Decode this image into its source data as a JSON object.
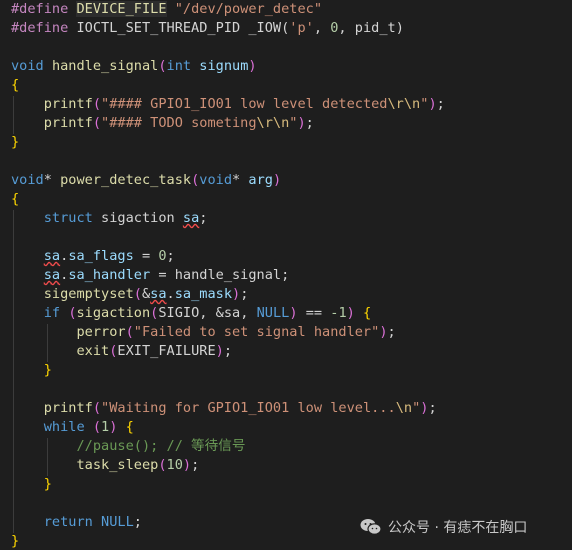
{
  "code_lines": [
    [
      {
        "c": "tok-pp",
        "t": "#define "
      },
      {
        "c": "tok-hl",
        "t": "DEVICE_FILE"
      },
      {
        "c": "tok-plain",
        "t": " "
      },
      {
        "c": "tok-str",
        "t": "\"/dev/power_detec\""
      }
    ],
    [
      {
        "c": "tok-pp",
        "t": "#define "
      },
      {
        "c": "tok-plain",
        "t": "IOCTL_SET_THREAD_PID _IOW("
      },
      {
        "c": "tok-str",
        "t": "'p'"
      },
      {
        "c": "tok-plain",
        "t": ", "
      },
      {
        "c": "tok-num",
        "t": "0"
      },
      {
        "c": "tok-plain",
        "t": ", pid_t)"
      }
    ],
    [],
    [
      {
        "c": "tok-kw",
        "t": "void"
      },
      {
        "c": "tok-plain",
        "t": " "
      },
      {
        "c": "tok-fn",
        "t": "handle_signal"
      },
      {
        "c": "tok-paren",
        "t": "("
      },
      {
        "c": "tok-kw",
        "t": "int"
      },
      {
        "c": "tok-plain",
        "t": " "
      },
      {
        "c": "tok-var",
        "t": "signum"
      },
      {
        "c": "tok-paren",
        "t": ")"
      }
    ],
    [
      {
        "c": "tok-brace",
        "t": "{"
      }
    ],
    [
      {
        "c": "tok-plain",
        "t": "    "
      },
      {
        "c": "tok-fn",
        "t": "printf"
      },
      {
        "c": "tok-paren",
        "t": "("
      },
      {
        "c": "tok-str",
        "t": "\"#### GPIO1_IO01 low level detected"
      },
      {
        "c": "tok-esc",
        "t": "\\r\\n"
      },
      {
        "c": "tok-str",
        "t": "\""
      },
      {
        "c": "tok-paren",
        "t": ")"
      },
      {
        "c": "tok-plain",
        "t": ";"
      }
    ],
    [
      {
        "c": "tok-plain",
        "t": "    "
      },
      {
        "c": "tok-fn",
        "t": "printf"
      },
      {
        "c": "tok-paren",
        "t": "("
      },
      {
        "c": "tok-str",
        "t": "\"#### TODO someting"
      },
      {
        "c": "tok-esc",
        "t": "\\r\\n"
      },
      {
        "c": "tok-str",
        "t": "\""
      },
      {
        "c": "tok-paren",
        "t": ")"
      },
      {
        "c": "tok-plain",
        "t": ";"
      }
    ],
    [
      {
        "c": "tok-brace",
        "t": "}"
      }
    ],
    [],
    [
      {
        "c": "tok-kw",
        "t": "void"
      },
      {
        "c": "tok-plain",
        "t": "* "
      },
      {
        "c": "tok-fn",
        "t": "power_detec_task"
      },
      {
        "c": "tok-paren",
        "t": "("
      },
      {
        "c": "tok-kw",
        "t": "void"
      },
      {
        "c": "tok-plain",
        "t": "* "
      },
      {
        "c": "tok-var",
        "t": "arg"
      },
      {
        "c": "tok-paren",
        "t": ")"
      }
    ],
    [
      {
        "c": "tok-brace",
        "t": "{"
      }
    ],
    [
      {
        "c": "tok-plain",
        "t": "    "
      },
      {
        "c": "tok-kw",
        "t": "struct"
      },
      {
        "c": "tok-plain",
        "t": " sigaction "
      },
      {
        "c": "tok-var tok-sq",
        "t": "sa"
      },
      {
        "c": "tok-plain",
        "t": ";"
      }
    ],
    [],
    [
      {
        "c": "tok-plain",
        "t": "    "
      },
      {
        "c": "tok-var tok-sq",
        "t": "sa"
      },
      {
        "c": "tok-plain",
        "t": "."
      },
      {
        "c": "tok-var",
        "t": "sa_flags"
      },
      {
        "c": "tok-plain",
        "t": " = "
      },
      {
        "c": "tok-num",
        "t": "0"
      },
      {
        "c": "tok-plain",
        "t": ";"
      }
    ],
    [
      {
        "c": "tok-plain",
        "t": "    "
      },
      {
        "c": "tok-var tok-sq",
        "t": "sa"
      },
      {
        "c": "tok-plain",
        "t": "."
      },
      {
        "c": "tok-var",
        "t": "sa_handler"
      },
      {
        "c": "tok-plain",
        "t": " = handle_signal;"
      }
    ],
    [
      {
        "c": "tok-plain",
        "t": "    "
      },
      {
        "c": "tok-fn",
        "t": "sigemptyset"
      },
      {
        "c": "tok-paren",
        "t": "("
      },
      {
        "c": "tok-plain",
        "t": "&"
      },
      {
        "c": "tok-var tok-sq",
        "t": "sa"
      },
      {
        "c": "tok-plain",
        "t": "."
      },
      {
        "c": "tok-var",
        "t": "sa_mask"
      },
      {
        "c": "tok-paren",
        "t": ")"
      },
      {
        "c": "tok-plain",
        "t": ";"
      }
    ],
    [
      {
        "c": "tok-plain",
        "t": "    "
      },
      {
        "c": "tok-kw",
        "t": "if"
      },
      {
        "c": "tok-plain",
        "t": " "
      },
      {
        "c": "tok-paren",
        "t": "("
      },
      {
        "c": "tok-fn",
        "t": "sigaction"
      },
      {
        "c": "tok-paren",
        "t": "("
      },
      {
        "c": "tok-plain",
        "t": "SIGIO, &sa, "
      },
      {
        "c": "tok-kw",
        "t": "NULL"
      },
      {
        "c": "tok-paren",
        "t": ")"
      },
      {
        "c": "tok-plain",
        "t": " == "
      },
      {
        "c": "tok-num",
        "t": "-1"
      },
      {
        "c": "tok-paren",
        "t": ")"
      },
      {
        "c": "tok-plain",
        "t": " "
      },
      {
        "c": "tok-brace",
        "t": "{"
      }
    ],
    [
      {
        "c": "tok-plain",
        "t": "        "
      },
      {
        "c": "tok-fn",
        "t": "perror"
      },
      {
        "c": "tok-paren",
        "t": "("
      },
      {
        "c": "tok-str",
        "t": "\"Failed to set signal handler\""
      },
      {
        "c": "tok-paren",
        "t": ")"
      },
      {
        "c": "tok-plain",
        "t": ";"
      }
    ],
    [
      {
        "c": "tok-plain",
        "t": "        "
      },
      {
        "c": "tok-fn",
        "t": "exit"
      },
      {
        "c": "tok-paren",
        "t": "("
      },
      {
        "c": "tok-plain",
        "t": "EXIT_FAILURE"
      },
      {
        "c": "tok-paren",
        "t": ")"
      },
      {
        "c": "tok-plain",
        "t": ";"
      }
    ],
    [
      {
        "c": "tok-plain",
        "t": "    "
      },
      {
        "c": "tok-brace",
        "t": "}"
      }
    ],
    [],
    [
      {
        "c": "tok-plain",
        "t": "    "
      },
      {
        "c": "tok-fn",
        "t": "printf"
      },
      {
        "c": "tok-paren",
        "t": "("
      },
      {
        "c": "tok-str",
        "t": "\"Waiting for GPIO1_IO01 low level..."
      },
      {
        "c": "tok-esc",
        "t": "\\n"
      },
      {
        "c": "tok-str",
        "t": "\""
      },
      {
        "c": "tok-paren",
        "t": ")"
      },
      {
        "c": "tok-plain",
        "t": ";"
      }
    ],
    [
      {
        "c": "tok-plain",
        "t": "    "
      },
      {
        "c": "tok-kw",
        "t": "while"
      },
      {
        "c": "tok-plain",
        "t": " "
      },
      {
        "c": "tok-paren",
        "t": "("
      },
      {
        "c": "tok-num",
        "t": "1"
      },
      {
        "c": "tok-paren",
        "t": ")"
      },
      {
        "c": "tok-plain",
        "t": " "
      },
      {
        "c": "tok-brace",
        "t": "{"
      }
    ],
    [
      {
        "c": "tok-plain",
        "t": "        "
      },
      {
        "c": "tok-com",
        "t": "//pause(); // 等待信号"
      }
    ],
    [
      {
        "c": "tok-plain",
        "t": "        "
      },
      {
        "c": "tok-fn",
        "t": "task_sleep"
      },
      {
        "c": "tok-paren",
        "t": "("
      },
      {
        "c": "tok-num",
        "t": "10"
      },
      {
        "c": "tok-paren",
        "t": ")"
      },
      {
        "c": "tok-plain",
        "t": ";"
      }
    ],
    [
      {
        "c": "tok-plain",
        "t": "    "
      },
      {
        "c": "tok-brace",
        "t": "}"
      }
    ],
    [],
    [
      {
        "c": "tok-plain",
        "t": "    "
      },
      {
        "c": "tok-kw",
        "t": "return"
      },
      {
        "c": "tok-plain",
        "t": " "
      },
      {
        "c": "tok-kw",
        "t": "NULL"
      },
      {
        "c": "tok-plain",
        "t": ";"
      }
    ],
    [
      {
        "c": "tok-brace",
        "t": "}"
      }
    ]
  ],
  "watermark": {
    "icon": "wechat-icon",
    "text": "公众号 · 有痣不在胸口"
  },
  "colors": {
    "background": "#1e1e1e",
    "keyword": "#569cd6",
    "string": "#ce9178",
    "function": "#dcdcaa",
    "number": "#b5cea8",
    "comment": "#6a9955",
    "squiggle": "#f14c4c"
  }
}
